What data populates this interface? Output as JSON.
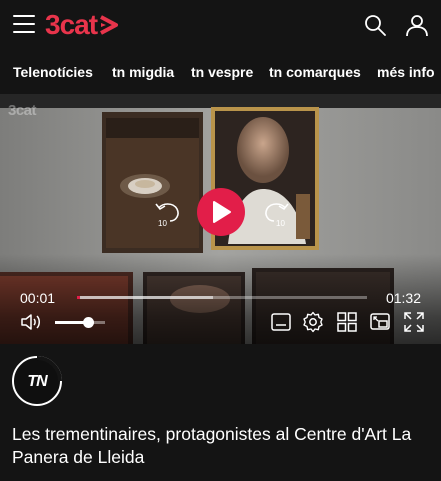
{
  "header": {
    "brand": "3cat",
    "menu_icon": "hamburger-menu-icon",
    "search_icon": "search-icon",
    "user_icon": "user-icon",
    "brand_color": "#e8344b"
  },
  "nav": {
    "items": [
      {
        "label": "Telenotícies"
      },
      {
        "label": "tn migdia"
      },
      {
        "label": "tn vespre"
      },
      {
        "label": "tn comarques"
      },
      {
        "label": "més info"
      }
    ]
  },
  "player": {
    "watermark": "3cat",
    "current_time": "00:01",
    "duration": "01:32",
    "progress_fraction": 0.01,
    "buffered_fraction": 0.47,
    "volume_fraction": 0.65,
    "skip_back_seconds": "10",
    "skip_forward_seconds": "10",
    "accent_color": "#e21e49",
    "controls": [
      "subtitles-icon",
      "settings-icon",
      "grid-icon",
      "picture-in-picture-icon",
      "fullscreen-icon"
    ]
  },
  "video": {
    "channel_logo_text": "TN",
    "title": "Les trementinaires, protagonistes al Centre d'Art La Panera de Lleida"
  }
}
